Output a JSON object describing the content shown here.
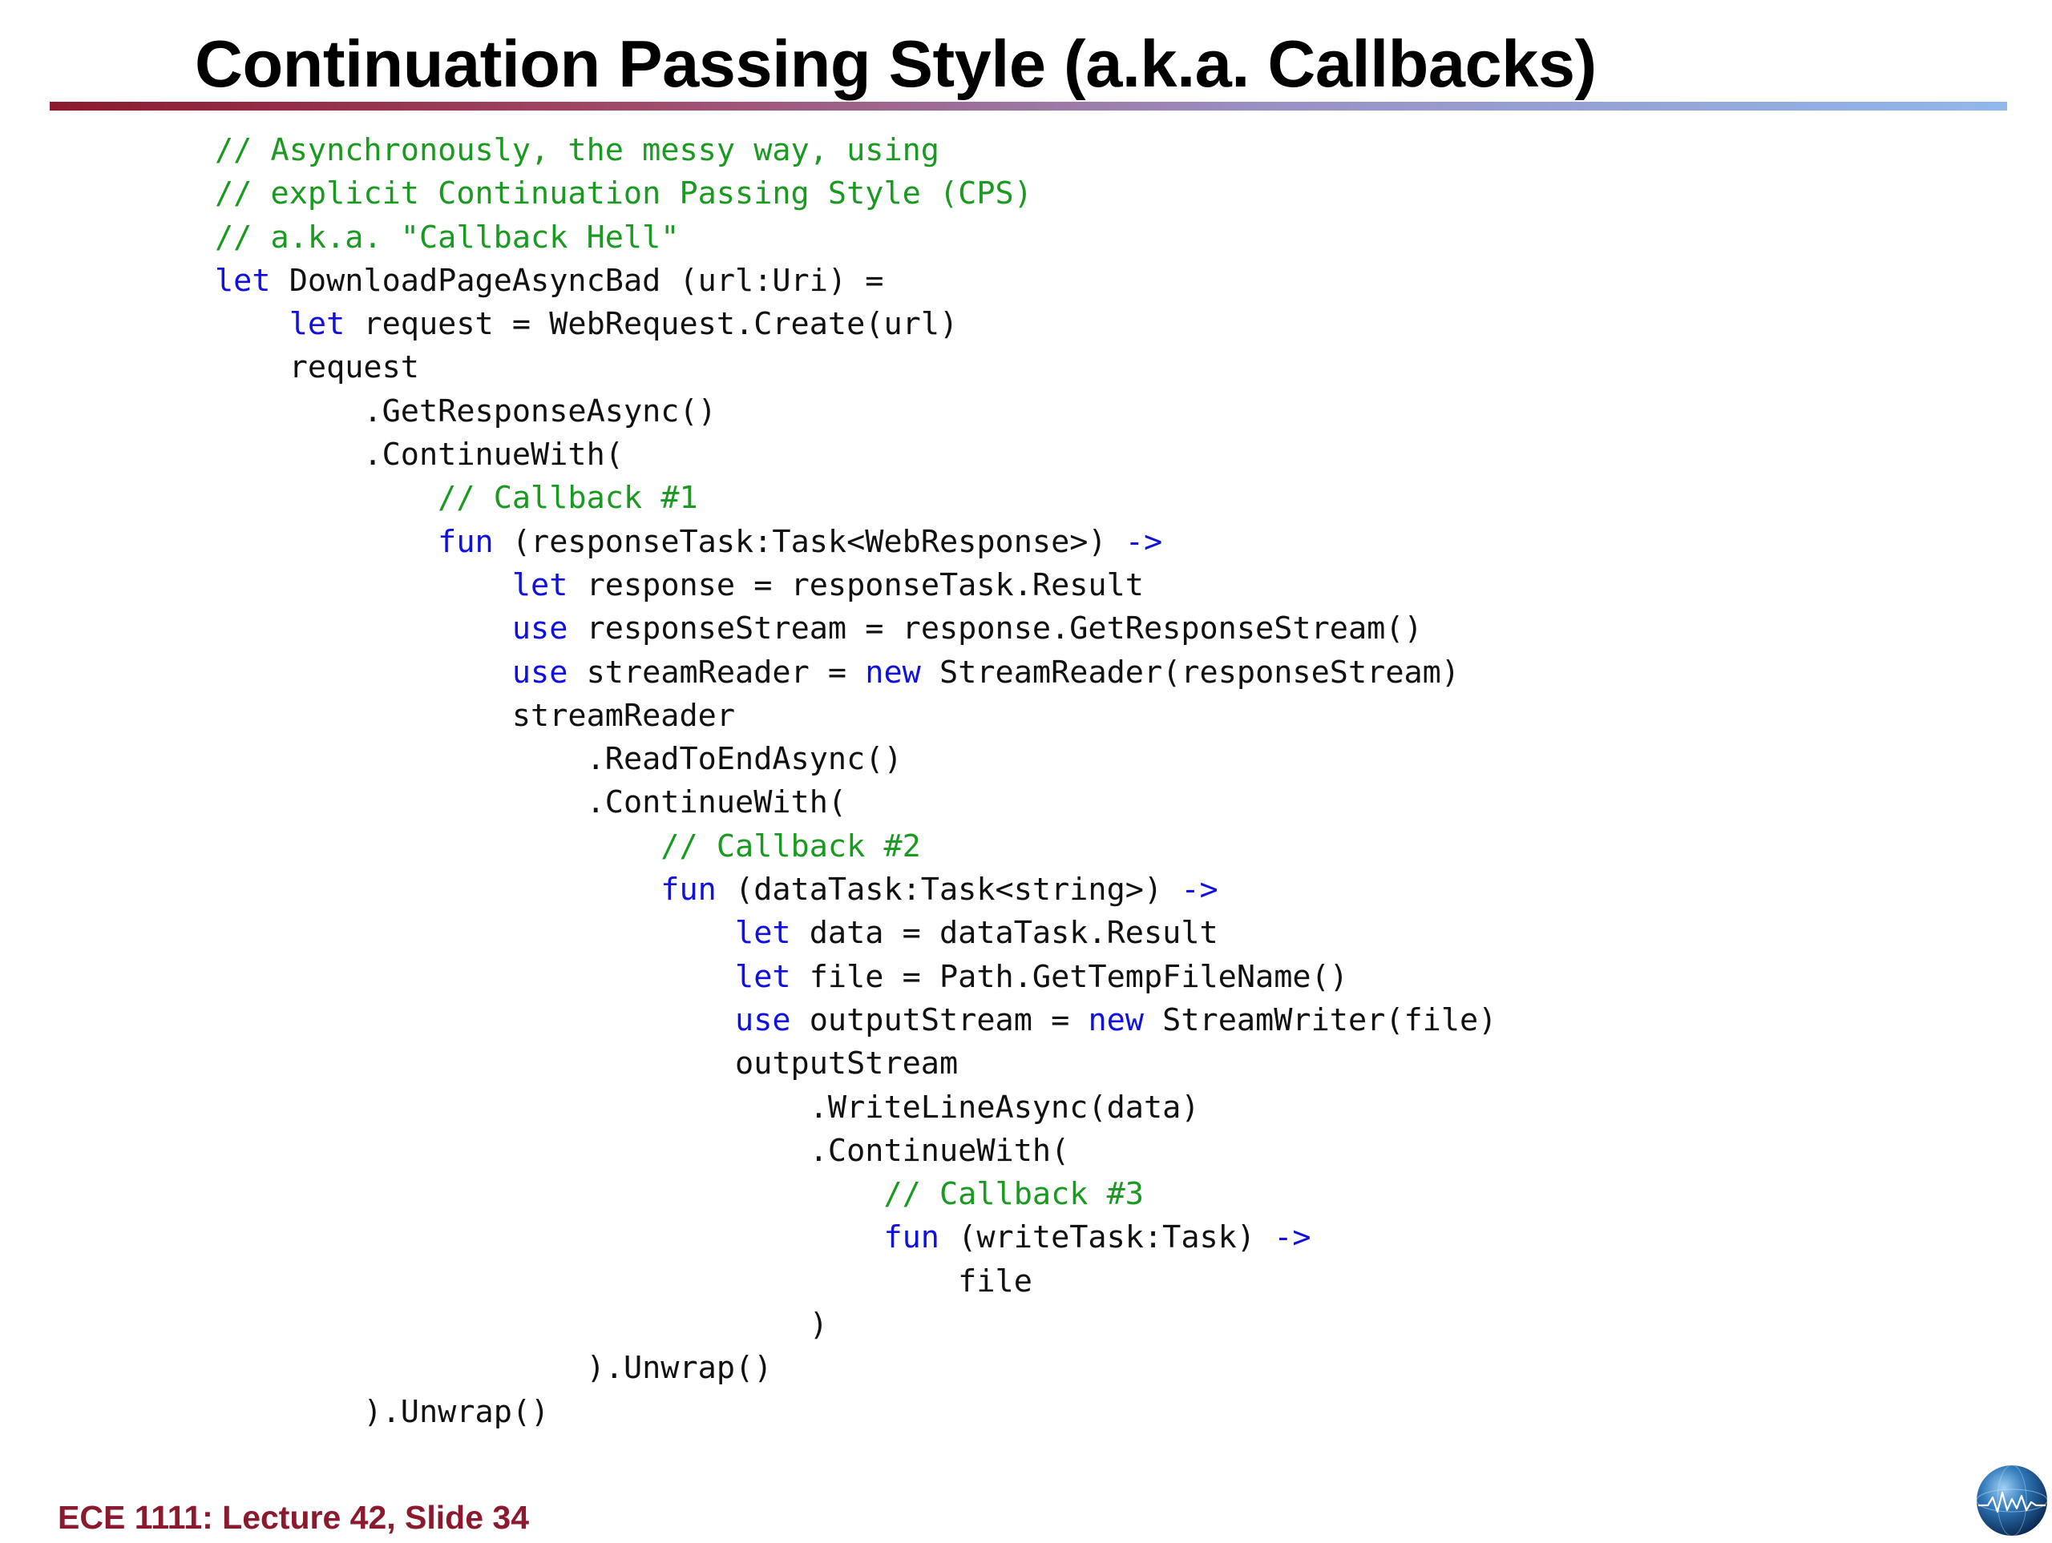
{
  "slide": {
    "title": "Continuation Passing Style (a.k.a. Callbacks)",
    "footer": "ECE 1111: Lecture 42, Slide 34"
  },
  "colors": {
    "title_text": "#000000",
    "rule_left": "#8b1a2e",
    "rule_right": "#8fb8ec",
    "comment": "#1a9a20",
    "keyword": "#1010e0",
    "code_text": "#111111",
    "footer_text": "#8b1a2e"
  },
  "icons": {
    "logo": "globe-waveform-logo-icon"
  },
  "code_lines": [
    {
      "indent": 0,
      "tokens": [
        {
          "t": "c",
          "s": "// Asynchronously, the messy way, using"
        }
      ]
    },
    {
      "indent": 0,
      "tokens": [
        {
          "t": "c",
          "s": "// explicit Continuation Passing Style (CPS)"
        }
      ]
    },
    {
      "indent": 0,
      "tokens": [
        {
          "t": "c",
          "s": "// a.k.a. \"Callback Hell\""
        }
      ]
    },
    {
      "indent": 0,
      "tokens": [
        {
          "t": "k",
          "s": "let"
        },
        {
          "t": "p",
          "s": " DownloadPageAsyncBad (url:Uri) ="
        }
      ]
    },
    {
      "indent": 4,
      "tokens": [
        {
          "t": "k",
          "s": "let"
        },
        {
          "t": "p",
          "s": " request = WebRequest.Create(url)"
        }
      ]
    },
    {
      "indent": 4,
      "tokens": [
        {
          "t": "p",
          "s": "request"
        }
      ]
    },
    {
      "indent": 8,
      "tokens": [
        {
          "t": "p",
          "s": ".GetResponseAsync()"
        }
      ]
    },
    {
      "indent": 8,
      "tokens": [
        {
          "t": "p",
          "s": ".ContinueWith("
        }
      ]
    },
    {
      "indent": 12,
      "tokens": [
        {
          "t": "c",
          "s": "// Callback #1"
        }
      ]
    },
    {
      "indent": 12,
      "tokens": [
        {
          "t": "k",
          "s": "fun"
        },
        {
          "t": "p",
          "s": " (responseTask:Task<WebResponse>) "
        },
        {
          "t": "k",
          "s": "->"
        }
      ]
    },
    {
      "indent": 16,
      "tokens": [
        {
          "t": "k",
          "s": "let"
        },
        {
          "t": "p",
          "s": " response = responseTask.Result"
        }
      ]
    },
    {
      "indent": 16,
      "tokens": [
        {
          "t": "k",
          "s": "use"
        },
        {
          "t": "p",
          "s": " responseStream = response.GetResponseStream()"
        }
      ]
    },
    {
      "indent": 16,
      "tokens": [
        {
          "t": "k",
          "s": "use"
        },
        {
          "t": "p",
          "s": " streamReader = "
        },
        {
          "t": "k",
          "s": "new"
        },
        {
          "t": "p",
          "s": " StreamReader(responseStream)"
        }
      ]
    },
    {
      "indent": 16,
      "tokens": [
        {
          "t": "p",
          "s": "streamReader"
        }
      ]
    },
    {
      "indent": 20,
      "tokens": [
        {
          "t": "p",
          "s": ".ReadToEndAsync()"
        }
      ]
    },
    {
      "indent": 20,
      "tokens": [
        {
          "t": "p",
          "s": ".ContinueWith("
        }
      ]
    },
    {
      "indent": 24,
      "tokens": [
        {
          "t": "c",
          "s": "// Callback #2"
        }
      ]
    },
    {
      "indent": 24,
      "tokens": [
        {
          "t": "k",
          "s": "fun"
        },
        {
          "t": "p",
          "s": " (dataTask:Task<string>) "
        },
        {
          "t": "k",
          "s": "->"
        }
      ]
    },
    {
      "indent": 28,
      "tokens": [
        {
          "t": "k",
          "s": "let"
        },
        {
          "t": "p",
          "s": " data = dataTask.Result"
        }
      ]
    },
    {
      "indent": 28,
      "tokens": [
        {
          "t": "k",
          "s": "let"
        },
        {
          "t": "p",
          "s": " file = Path.GetTempFileName()"
        }
      ]
    },
    {
      "indent": 28,
      "tokens": [
        {
          "t": "k",
          "s": "use"
        },
        {
          "t": "p",
          "s": " outputStream = "
        },
        {
          "t": "k",
          "s": "new"
        },
        {
          "t": "p",
          "s": " StreamWriter(file)"
        }
      ]
    },
    {
      "indent": 28,
      "tokens": [
        {
          "t": "p",
          "s": "outputStream"
        }
      ]
    },
    {
      "indent": 32,
      "tokens": [
        {
          "t": "p",
          "s": ".WriteLineAsync(data)"
        }
      ]
    },
    {
      "indent": 32,
      "tokens": [
        {
          "t": "p",
          "s": ".ContinueWith("
        }
      ]
    },
    {
      "indent": 36,
      "tokens": [
        {
          "t": "c",
          "s": "// Callback #3"
        }
      ]
    },
    {
      "indent": 36,
      "tokens": [
        {
          "t": "k",
          "s": "fun"
        },
        {
          "t": "p",
          "s": " (writeTask:Task) "
        },
        {
          "t": "k",
          "s": "->"
        }
      ]
    },
    {
      "indent": 40,
      "tokens": [
        {
          "t": "p",
          "s": "file"
        }
      ]
    },
    {
      "indent": 32,
      "tokens": [
        {
          "t": "p",
          "s": ")"
        }
      ]
    },
    {
      "indent": 20,
      "tokens": [
        {
          "t": "p",
          "s": ").Unwrap()"
        }
      ]
    },
    {
      "indent": 8,
      "tokens": [
        {
          "t": "p",
          "s": ").Unwrap()"
        }
      ]
    }
  ]
}
